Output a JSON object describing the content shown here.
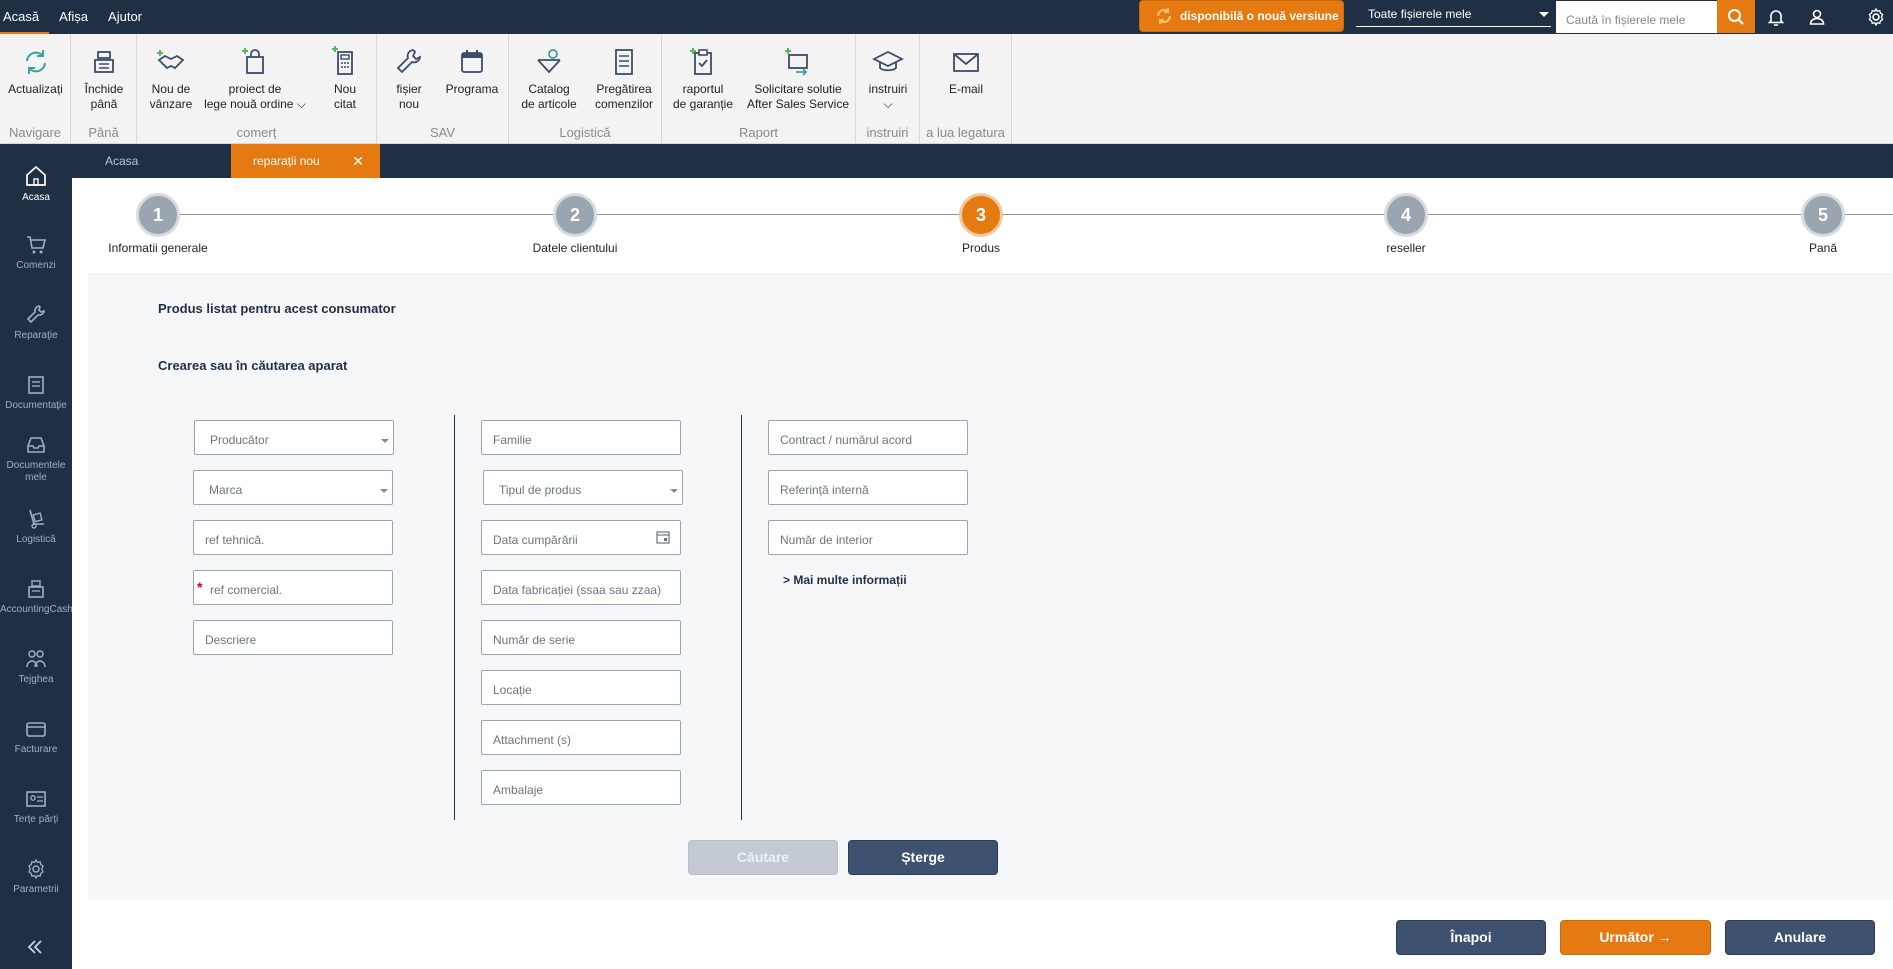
{
  "menu": {
    "items": [
      "Acasă",
      "Afișa",
      "Ajutor"
    ]
  },
  "top": {
    "update_label": "disponibilă o nouă versiune",
    "files_select": "Toate fișierele mele",
    "search_placeholder": "Caută în fișierele mele"
  },
  "ribbon": {
    "groups": {
      "navigare": "Navigare",
      "pana": "Până",
      "comert": "comerț",
      "sav": "SAV",
      "logistica": "Logistică",
      "raport": "Raport",
      "instruiri": "instruiri",
      "contact": "a lua legatura"
    },
    "buttons": {
      "actualizati": "Actualizați",
      "inchide_l1": "Închide",
      "inchide_l2": "până",
      "nou_vanzare_l1": "Nou de",
      "nou_vanzare_l2": "vânzare",
      "proiect_l1": "proiect de",
      "proiect_l2": "lege nouă ordine",
      "nou_citat_l1": "Nou",
      "nou_citat_l2": "citat",
      "fisier_l1": "fișier",
      "fisier_l2": "nou",
      "programa": "Programa",
      "catalog_l1": "Catalog",
      "catalog_l2": "de articole",
      "pregatirea_l1": "Pregătirea",
      "pregatirea_l2": "comenzilor",
      "raportul_l1": "raportul",
      "raportul_l2": "de garanție",
      "solicitare_l1": "Solicitare solutie",
      "solicitare_l2": "After Sales Service",
      "instruiri": "instruiri",
      "email": "E-mail"
    }
  },
  "tabs": {
    "home": "Acasa",
    "active": "reparații nou"
  },
  "sidebar": {
    "items": [
      "Acasa",
      "Comenzi",
      "Reparaţie",
      "Documentaţie",
      "Documentele",
      "mele",
      "Logistică",
      "AccountingCash",
      "Tejghea",
      "Facturare",
      "Terțe părți",
      "Parametrii"
    ]
  },
  "steps": [
    {
      "num": "1",
      "label": "Informatii generale"
    },
    {
      "num": "2",
      "label": "Datele clientului"
    },
    {
      "num": "3",
      "label": "Produs"
    },
    {
      "num": "4",
      "label": "reseller"
    },
    {
      "num": "5",
      "label": "Pană"
    }
  ],
  "form": {
    "section_listed": "Produs listat pentru acest consumator",
    "section_create": "Crearea sau în căutarea aparat",
    "col1": {
      "producator": "Producător",
      "marca": "Marca",
      "ref_tehnica": "ref tehnică.",
      "ref_comercial": "ref comercial.",
      "descriere": "Descriere",
      "required_mark": "*"
    },
    "col2": {
      "familie": "Familie",
      "tipul": "Tipul de produs",
      "data_cumpararii": "Data cumpărării",
      "data_fabricatiei": "Data fabricației (ssaa sau zzaa)",
      "numar_serie": "Număr de serie",
      "locatie": "Locație",
      "attachment": "Attachment (s)",
      "ambalaje": "Ambalaje"
    },
    "col3": {
      "contract": "Contract / numărul acord",
      "referinta": "Referință internă",
      "numar_interior": "Număr de interior",
      "more_info": "> Mai multe informații"
    },
    "search_btn": "Căutare",
    "clear_btn": "Șterge"
  },
  "footer": {
    "back": "Înapoi",
    "next": "Următor →",
    "cancel": "Anulare"
  }
}
